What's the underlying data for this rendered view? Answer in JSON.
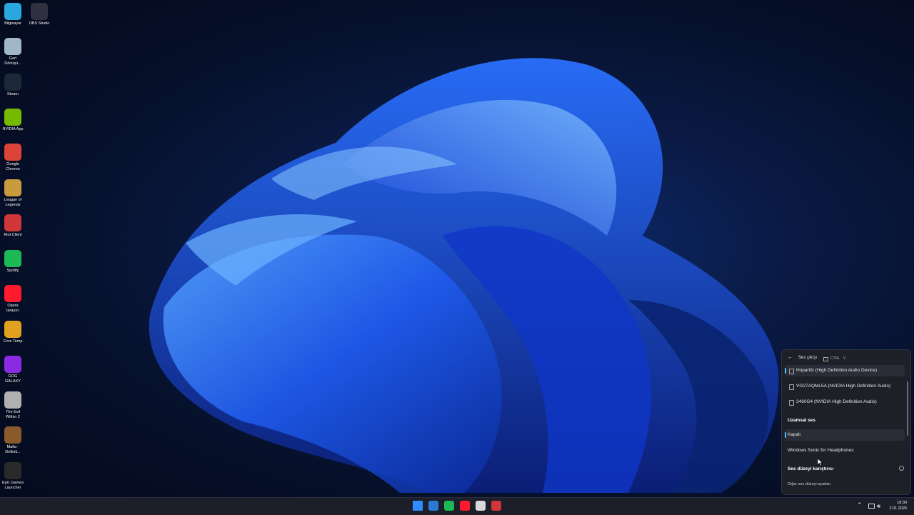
{
  "desktop": {
    "icons": [
      {
        "label": "Bilgisayar",
        "icon": "monitor-icon",
        "color": "#29a8e0"
      },
      {
        "label": "OBS Studio",
        "icon": "obs-icon",
        "color": "#303040"
      },
      {
        "label": "Geri\nDönüşü...",
        "icon": "recycle-bin-icon",
        "color": "#9fb7c8"
      },
      {
        "label": "Steam",
        "icon": "steam-icon",
        "color": "#1b2838"
      },
      {
        "label": "NVIDIA App",
        "icon": "nvidia-icon",
        "color": "#76b900"
      },
      {
        "label": "Google\nChrome",
        "icon": "chrome-icon",
        "color": "#db4437"
      },
      {
        "label": "League of\nLegends",
        "icon": "league-icon",
        "color": "#c89b3c"
      },
      {
        "label": "Riot Client",
        "icon": "riot-icon",
        "color": "#d13639"
      },
      {
        "label": "Spotify",
        "icon": "spotify-icon",
        "color": "#1db954"
      },
      {
        "label": "Opera\ntarayıcı",
        "icon": "opera-icon",
        "color": "#ff1b2d"
      },
      {
        "label": "Core Temp",
        "icon": "core-temp-icon",
        "color": "#e0a020"
      },
      {
        "label": "GOG\nGALAXY",
        "icon": "gog-icon",
        "color": "#8a2be2"
      },
      {
        "label": "The Evil\nWithin 2",
        "icon": "evil-within-icon",
        "color": "#b0b0b0"
      },
      {
        "label": "Mafia -\nDefiniti...",
        "icon": "mafia-icon",
        "color": "#8b5a2b"
      },
      {
        "label": "Epic Games\nLauncher",
        "icon": "epic-icon",
        "color": "#2a2a2a"
      }
    ]
  },
  "flyout": {
    "header": {
      "title": "Ses çıkışı",
      "shortcut": "CTRL",
      "shortcut_key": "V"
    },
    "devices": [
      {
        "label": "Hoparlör (High Definition Audio Device)",
        "selected": true
      },
      {
        "label": "VG27AQML5A (NVIDIA High Definition Audio)",
        "selected": false
      },
      {
        "label": "2460G4 (NVIDIA High Definition Audio)",
        "selected": false
      }
    ],
    "spatial": {
      "heading": "Uzamsal ses",
      "options": [
        {
          "label": "Kapalı",
          "selected": true
        },
        {
          "label": "Windows Sonic for Headphones",
          "selected": false
        }
      ]
    },
    "mixer_label": "Ses düzeyi karıştırıcı",
    "more_settings": "Diğer ses düzeyi ayarları"
  },
  "taskbar": {
    "apps": [
      {
        "name": "start",
        "icon": "windows-start-icon",
        "color": "#2f8cff"
      },
      {
        "name": "edge",
        "icon": "edge-icon",
        "color": "#2b7bd6"
      },
      {
        "name": "spotify",
        "icon": "spotify-icon",
        "color": "#1db954"
      },
      {
        "name": "opera",
        "icon": "opera-icon",
        "color": "#ff1b2d"
      },
      {
        "name": "notepad",
        "icon": "notepad-icon",
        "color": "#d9d9d9"
      },
      {
        "name": "riot",
        "icon": "riot-icon",
        "color": "#d13639"
      }
    ],
    "clock": {
      "time": "18:30",
      "date": "2.01.2026"
    }
  },
  "colors": {
    "accent": "#4cc2ff",
    "panel": "#1e2028",
    "taskbar": "#1c1f29"
  }
}
